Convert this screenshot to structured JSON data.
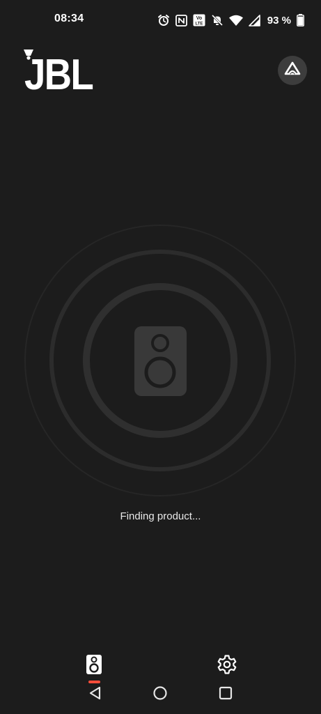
{
  "status_bar": {
    "time": "08:34",
    "icons": [
      "alarm-icon",
      "nfc-icon",
      "volte-icon",
      "silent-bell-icon",
      "wifi-icon",
      "signal-icon"
    ],
    "volte_label_top": "Vo",
    "volte_label_bottom": "LTE",
    "battery_text": "93 %",
    "battery_level_percent": 93
  },
  "header": {
    "logo_text": "JBL",
    "assistant_icon": "assistant-icon"
  },
  "main": {
    "status_text": "Finding product...",
    "center_icon": "speaker-icon"
  },
  "bottom_nav": {
    "tabs": [
      {
        "id": "devices",
        "icon": "speaker-icon",
        "active": true
      },
      {
        "id": "settings",
        "icon": "gear-icon",
        "active": false
      }
    ],
    "accent_color": "#ff4d3a"
  },
  "system_nav": {
    "buttons": [
      "back-icon",
      "home-icon",
      "recents-icon"
    ]
  },
  "colors": {
    "background": "#1c1c1c",
    "ring": "#2e2e2e",
    "speaker": "#393939"
  }
}
